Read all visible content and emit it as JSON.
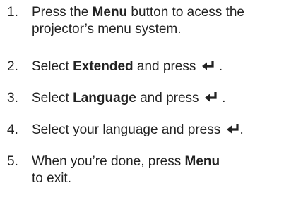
{
  "steps": [
    {
      "number": "1.",
      "pre": "Press the ",
      "bold": "Menu",
      "post": " button to acess the",
      "line2": "projector’s menu system."
    },
    {
      "number": "2.",
      "pre": "Select ",
      "bold": "Extended",
      "post": " and press",
      "icon": "enter-icon"
    },
    {
      "number": "3.",
      "pre": "Select ",
      "bold": "Language",
      "post": " and press",
      "icon": "enter-icon"
    },
    {
      "number": "4.",
      "pre": "Select your language and press",
      "icon": "enter-icon"
    },
    {
      "number": "5.",
      "pre": "When you’re done, press ",
      "bold": "Menu",
      "line2": "to exit."
    }
  ],
  "colors": {
    "text": "#222222",
    "background": "#ffffff"
  }
}
